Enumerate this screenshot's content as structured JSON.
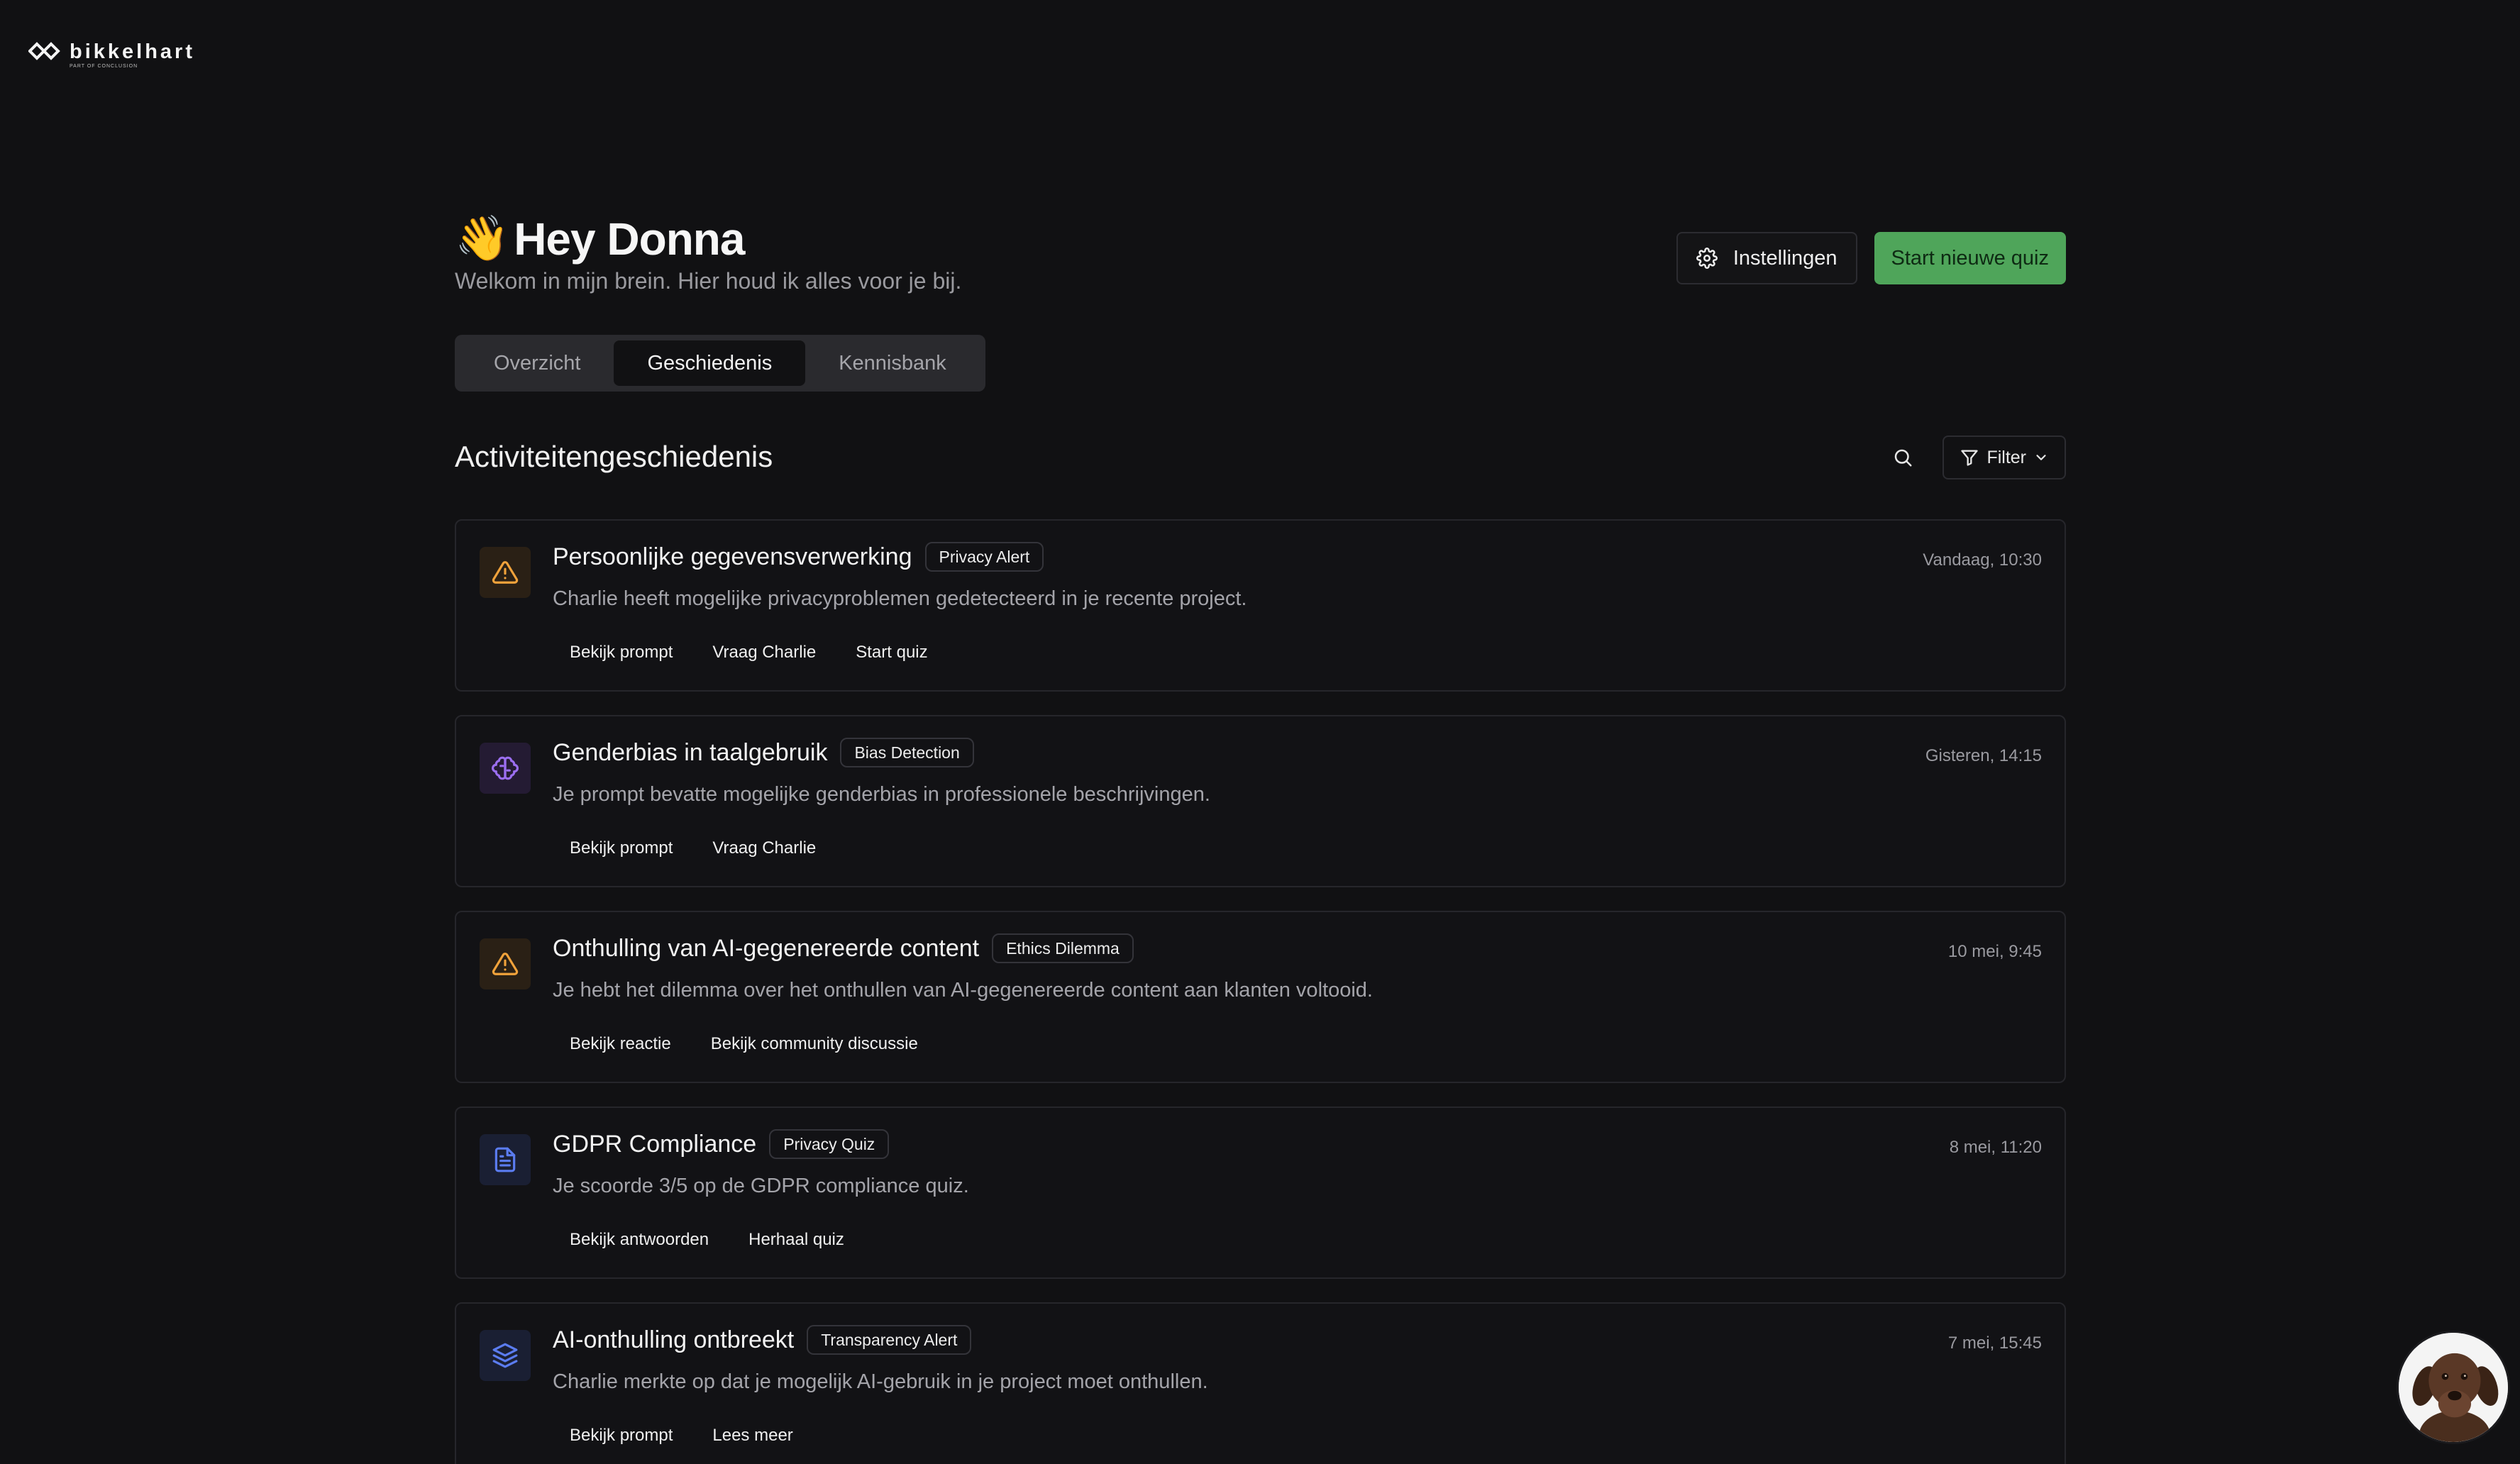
{
  "brand": {
    "name": "bikkelhart",
    "sub": "PART OF CONCLUSION"
  },
  "header": {
    "wave": "👋",
    "title": "Hey Donna",
    "subtitle": "Welkom in mijn brein. Hier houd ik alles voor je bij.",
    "settings_label": "Instellingen",
    "start_label": "Start nieuwe quiz"
  },
  "tabs": [
    {
      "label": "Overzicht",
      "active": false
    },
    {
      "label": "Geschiedenis",
      "active": true
    },
    {
      "label": "Kennisbank",
      "active": false
    }
  ],
  "section": {
    "title": "Activiteitengeschiedenis",
    "filter_label": "Filter"
  },
  "cards": [
    {
      "icon": "warning-icon",
      "title": "Persoonlijke gegevensverwerking",
      "badge": "Privacy Alert",
      "time": "Vandaag, 10:30",
      "desc": "Charlie heeft mogelijke privacyproblemen gedetecteerd in je recente project.",
      "actions": [
        "Bekijk prompt",
        "Vraag Charlie",
        "Start quiz"
      ]
    },
    {
      "icon": "brain-icon",
      "title": "Genderbias in taalgebruik",
      "badge": "Bias Detection",
      "time": "Gisteren, 14:15",
      "desc": "Je prompt bevatte mogelijke genderbias in professionele beschrijvingen.",
      "actions": [
        "Bekijk prompt",
        "Vraag Charlie"
      ]
    },
    {
      "icon": "warning-icon",
      "title": "Onthulling van AI-gegenereerde content",
      "badge": "Ethics Dilemma",
      "time": "10 mei, 9:45",
      "desc": "Je hebt het dilemma over het onthullen van AI-gegenereerde content aan klanten voltooid.",
      "actions": [
        "Bekijk reactie",
        "Bekijk community discussie"
      ]
    },
    {
      "icon": "document-icon",
      "title": "GDPR Compliance",
      "badge": "Privacy Quiz",
      "time": "8 mei, 11:20",
      "desc": "Je scoorde 3/5 op de GDPR compliance quiz.",
      "actions": [
        "Bekijk antwoorden",
        "Herhaal quiz"
      ]
    },
    {
      "icon": "layers-icon",
      "title": "AI-onthulling ontbreekt",
      "badge": "Transparency Alert",
      "time": "7 mei, 15:45",
      "desc": "Charlie merkte op dat je mogelijk AI-gebruik in je project moet onthullen.",
      "actions": [
        "Bekijk prompt",
        "Lees meer"
      ]
    }
  ],
  "colors": {
    "background": "#111113",
    "primary": "#4fa55a",
    "warning": "#f0a23b",
    "brain": "#9b6ef0",
    "blue": "#5b7cf0"
  }
}
